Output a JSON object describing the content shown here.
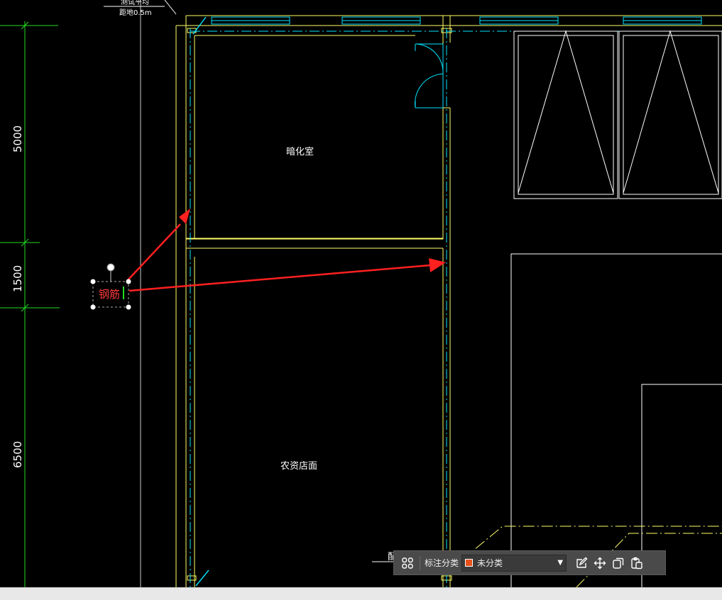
{
  "drawing": {
    "top_note_line1": "测试平均",
    "top_note_line2": "距地0.5m",
    "room_1_label": "暗化室",
    "room_2_label": "农资店面",
    "partial_label": "配",
    "dimensions": [
      "5000",
      "1500",
      "6500"
    ]
  },
  "annotation": {
    "text": "钢筋",
    "color": "#ff3b3b"
  },
  "toolbar": {
    "category_label": "标注分类",
    "category_value": "未分类",
    "category_color": "#e8501a",
    "icons": [
      "grid-icon",
      "edit-icon",
      "move-icon",
      "copy-icon",
      "paste-icon"
    ]
  },
  "colors": {
    "wall": "#ffff66",
    "axis": "#00e5ff",
    "dimension": "#22dd22",
    "furniture": "#ffffff",
    "arrow": "#ff2020"
  }
}
